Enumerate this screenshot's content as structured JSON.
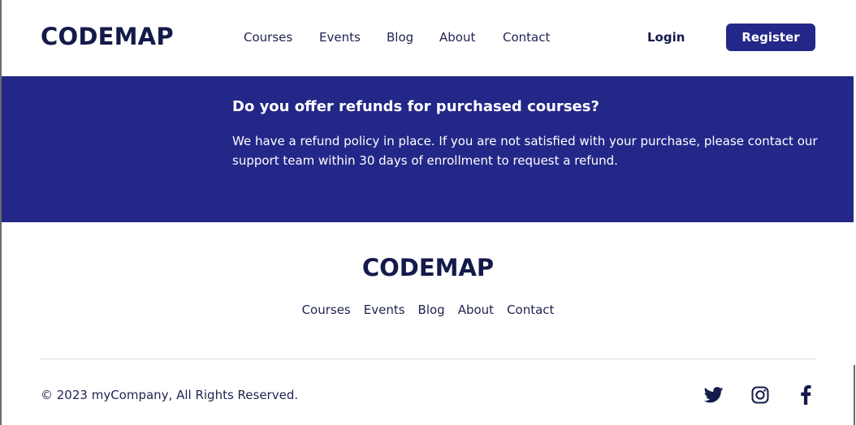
{
  "header": {
    "logo": "CODEMAP",
    "nav": [
      "Courses",
      "Events",
      "Blog",
      "About",
      "Contact"
    ],
    "login_label": "Login",
    "register_label": "Register"
  },
  "faq": {
    "question": "Do you offer refunds for purchased courses?",
    "answer": "We have a refund policy in place. If you are not satisfied with your purchase, please contact our support team within 30 days of enrollment to request a refund."
  },
  "footer": {
    "logo": "CODEMAP",
    "nav": [
      "Courses",
      "Events",
      "Blog",
      "About",
      "Contact"
    ],
    "copyright": "© 2023 myCompany, All Rights Reserved.",
    "social_icons": [
      "twitter-icon",
      "instagram-icon",
      "facebook-icon"
    ]
  },
  "colors": {
    "brand": "#232788",
    "text_dark": "#141a4a",
    "divider": "#d9d9d9"
  }
}
